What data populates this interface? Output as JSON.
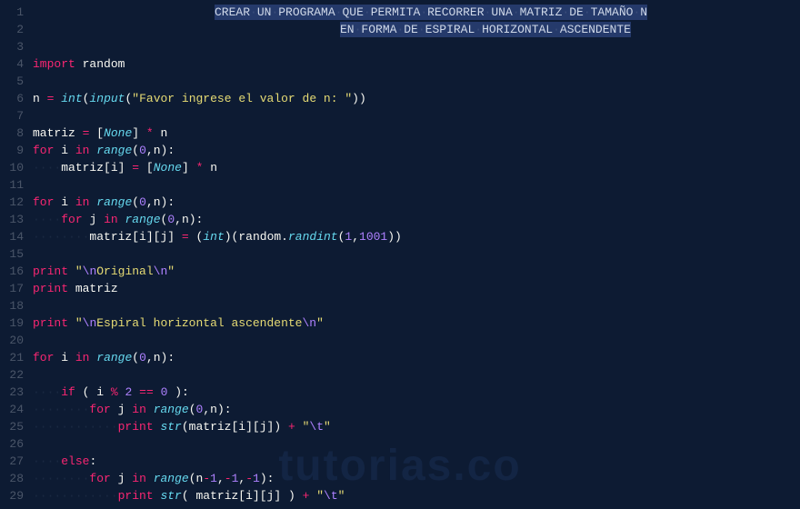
{
  "header": {
    "line1_segments": [
      "CREAR",
      "UN",
      "PROGRAMA",
      "QUE",
      "PERMITA",
      "RECORRER",
      "UNA",
      "MATRIZ",
      "DE",
      "TAMAÑO",
      "N"
    ],
    "line2_segments": [
      "EN",
      "FORMA",
      "DE",
      "ESPIRAL",
      "HORIZONTAL",
      "ASCENDENTE"
    ]
  },
  "code": {
    "import_kw": "import",
    "random": "random",
    "n_var": "n",
    "eq": "=",
    "int_fn": "int",
    "input_fn": "input",
    "input_prompt": "\"Favor ingrese el valor de n: \"",
    "matriz": "matriz",
    "none": "None",
    "star": "*",
    "for_kw": "for",
    "i_var": "i",
    "j_var": "j",
    "in_kw": "in",
    "range_fn": "range",
    "zero": "0",
    "one": "1",
    "neg1": "-1",
    "n1001": "1001",
    "randint": "randint",
    "print_kw": "print",
    "str_original": "\"\\nOriginal\\n\"",
    "str_espiral": "\"\\nEspiral horizontal ascendente\\n\"",
    "if_kw": "if",
    "else_kw": "else",
    "mod": "%",
    "two": "2",
    "eqeq": "==",
    "str_fn": "str",
    "plus": "+",
    "tab": "\"\\t\""
  },
  "line_numbers": [
    "1",
    "2",
    "3",
    "4",
    "5",
    "6",
    "7",
    "8",
    "9",
    "10",
    "11",
    "12",
    "13",
    "14",
    "15",
    "16",
    "17",
    "18",
    "19",
    "20",
    "21",
    "22",
    "23",
    "24",
    "25",
    "26",
    "27",
    "28",
    "29"
  ],
  "watermark": "tutorias.co"
}
